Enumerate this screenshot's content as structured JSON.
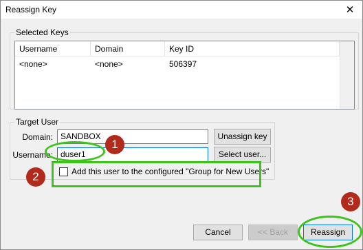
{
  "window": {
    "title": "Reassign Key",
    "close_label": "✕"
  },
  "selected_keys": {
    "group_label": "Selected Keys",
    "columns": [
      "Username",
      "Domain",
      "Key ID"
    ],
    "rows": [
      {
        "username": "<none>",
        "domain": "<none>",
        "key_id": "506397"
      }
    ]
  },
  "target_user": {
    "group_label": "Target User",
    "domain_label": "Domain:",
    "domain_value": "SANDBOX",
    "unassign_button": "Unassign key",
    "username_label": "Username:",
    "username_value": "duser1",
    "select_user_button": "Select user...",
    "checkbox_label": "Add this user to the configured \"Group for New Users\"",
    "checkbox_checked": false
  },
  "footer": {
    "cancel": "Cancel",
    "back": "<< Back",
    "reassign": "Reassign"
  },
  "annotations": {
    "badge_1": "1",
    "badge_2": "2",
    "badge_3": "3",
    "highlight_color": "#3ec21e",
    "badge_color": "#b22a1b"
  }
}
